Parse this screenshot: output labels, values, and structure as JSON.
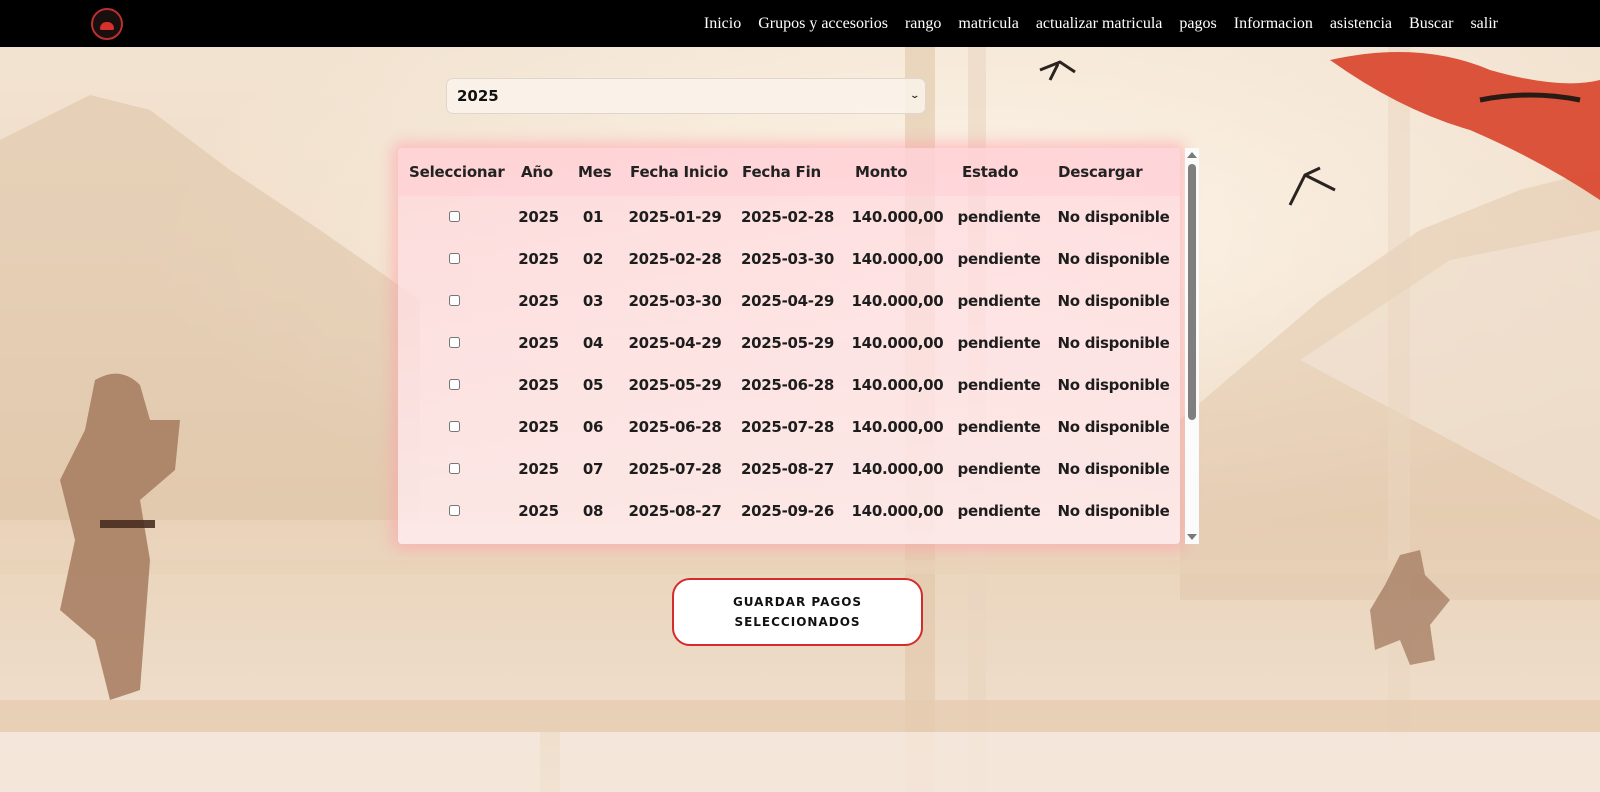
{
  "nav": {
    "logo_icon": "dojo-logo-icon",
    "links": [
      "Inicio",
      "Grupos y accesorios",
      "rango",
      "matricula",
      "actualizar matricula",
      "pagos",
      "Informacion",
      "asistencia",
      "Buscar",
      "salir"
    ]
  },
  "year_select": {
    "selected": "2025",
    "icon": "chevron-down-icon"
  },
  "table": {
    "headers": [
      "Seleccionar",
      "Año",
      "Mes",
      "Fecha Inicio",
      "Fecha Fin",
      "Monto",
      "Estado",
      "Descargar"
    ],
    "rows": [
      {
        "anio": "2025",
        "mes": "01",
        "inicio": "2025-01-29",
        "fin": "2025-02-28",
        "monto": "140.000,00",
        "estado": "pendiente",
        "descargar": "No disponible"
      },
      {
        "anio": "2025",
        "mes": "02",
        "inicio": "2025-02-28",
        "fin": "2025-03-30",
        "monto": "140.000,00",
        "estado": "pendiente",
        "descargar": "No disponible"
      },
      {
        "anio": "2025",
        "mes": "03",
        "inicio": "2025-03-30",
        "fin": "2025-04-29",
        "monto": "140.000,00",
        "estado": "pendiente",
        "descargar": "No disponible"
      },
      {
        "anio": "2025",
        "mes": "04",
        "inicio": "2025-04-29",
        "fin": "2025-05-29",
        "monto": "140.000,00",
        "estado": "pendiente",
        "descargar": "No disponible"
      },
      {
        "anio": "2025",
        "mes": "05",
        "inicio": "2025-05-29",
        "fin": "2025-06-28",
        "monto": "140.000,00",
        "estado": "pendiente",
        "descargar": "No disponible"
      },
      {
        "anio": "2025",
        "mes": "06",
        "inicio": "2025-06-28",
        "fin": "2025-07-28",
        "monto": "140.000,00",
        "estado": "pendiente",
        "descargar": "No disponible"
      },
      {
        "anio": "2025",
        "mes": "07",
        "inicio": "2025-07-28",
        "fin": "2025-08-27",
        "monto": "140.000,00",
        "estado": "pendiente",
        "descargar": "No disponible"
      },
      {
        "anio": "2025",
        "mes": "08",
        "inicio": "2025-08-27",
        "fin": "2025-09-26",
        "monto": "140.000,00",
        "estado": "pendiente",
        "descargar": "No disponible"
      }
    ]
  },
  "save_button": {
    "label": "GUARDAR PAGOS SELECCIONADOS"
  },
  "colors": {
    "nav_bg": "#000000",
    "accent": "#d62b2b",
    "table_bg": "#ffd7dc"
  }
}
